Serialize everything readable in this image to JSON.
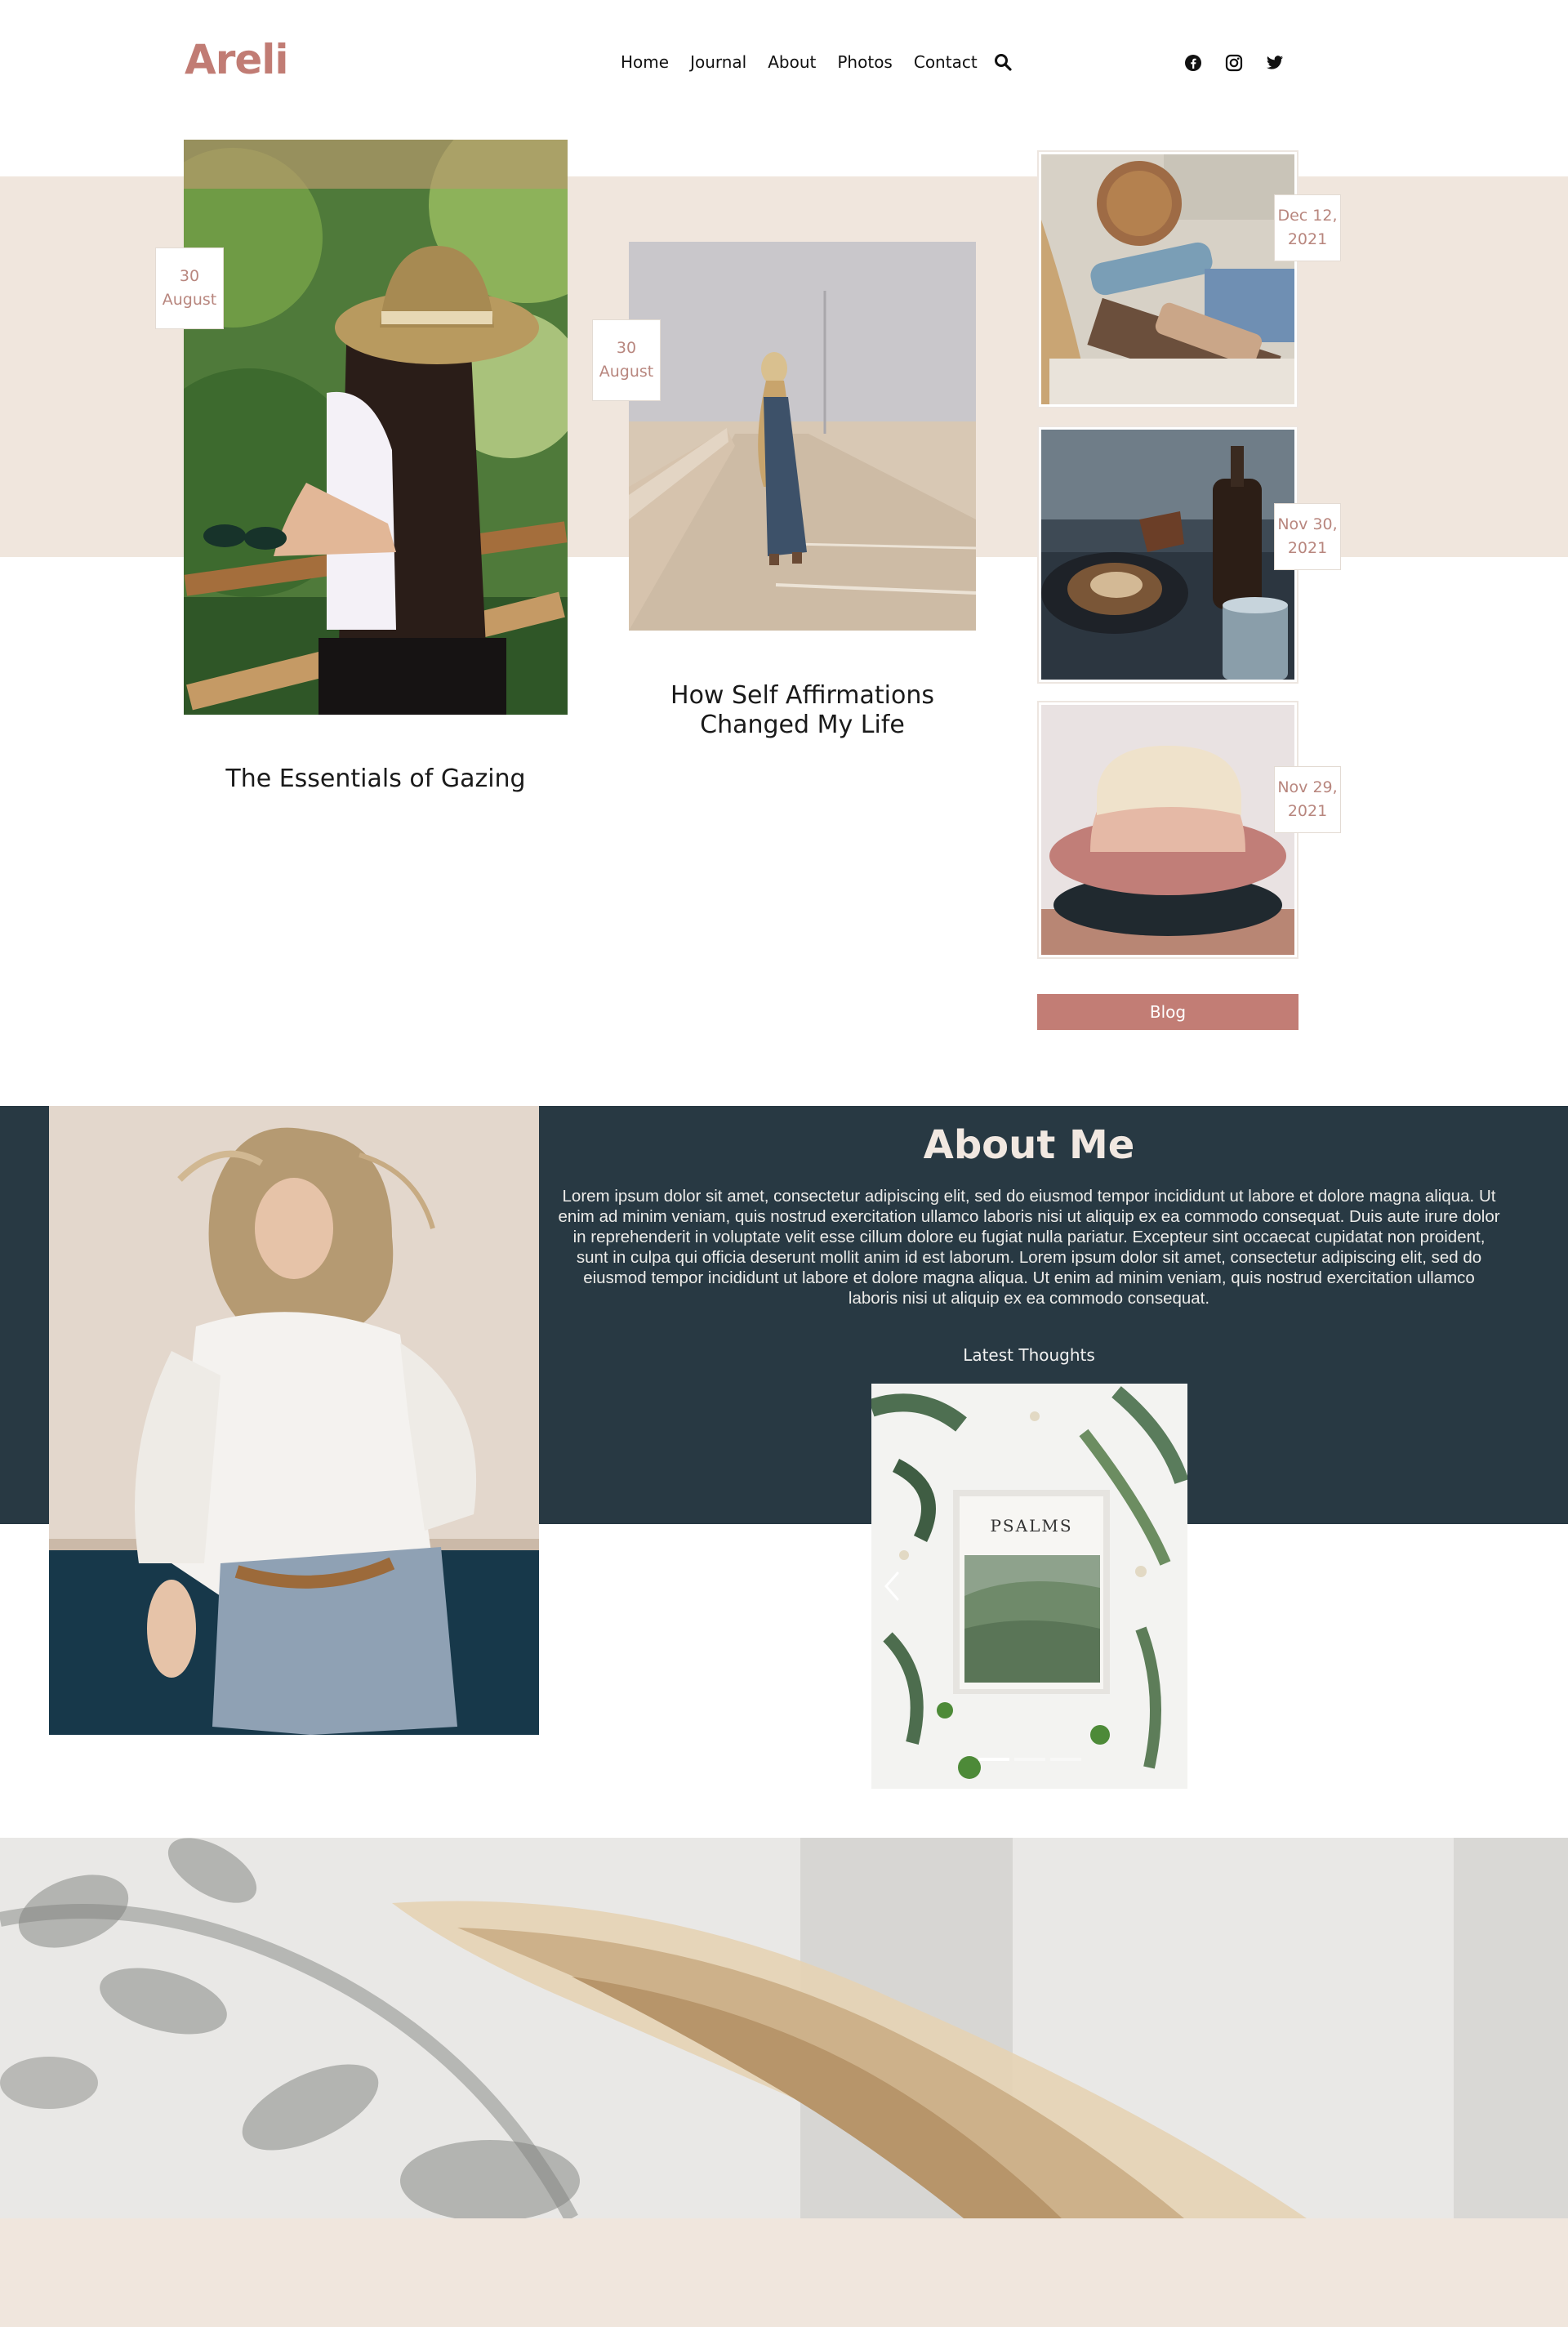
{
  "header": {
    "logo": "Areli",
    "nav": [
      "Home",
      "Journal",
      "About",
      "Photos",
      "Contact"
    ],
    "search_icon": "search-icon",
    "socials": [
      "facebook-icon",
      "instagram-icon",
      "twitter-icon"
    ]
  },
  "featured": [
    {
      "date_day": "30",
      "date_month": "August",
      "title": "The Essentials of Gazing"
    },
    {
      "date_day": "30",
      "date_month": "August",
      "title_line1": "How Self Affirmations",
      "title_line2": "Changed My Life"
    }
  ],
  "recent": [
    {
      "date_line1": "Dec 12,",
      "date_line2": "2021"
    },
    {
      "date_line1": "Nov 30,",
      "date_line2": "2021"
    },
    {
      "date_line1": "Nov 29,",
      "date_line2": "2021"
    }
  ],
  "blog_button": "Blog",
  "about": {
    "title": "About Me",
    "body": "Lorem ipsum dolor sit amet, consectetur adipiscing elit, sed do eiusmod tempor incididunt ut labore et dolore magna aliqua. Ut enim ad minim veniam, quis nostrud exercitation ullamco laboris nisi ut aliquip ex ea commodo consequat. Duis aute irure dolor in reprehenderit in voluptate velit esse cillum dolore eu fugiat nulla pariatur. Excepteur sint occaecat cupidatat non proident, sunt in culpa qui officia deserunt mollit anim id est laborum. Lorem ipsum dolor sit amet, consectetur adipiscing elit, sed do eiusmod tempor incididunt ut labore et dolore magna aliqua. Ut enim ad minim veniam, quis nostrud exercitation ullamco laboris nisi ut aliquip ex ea commodo consequat.",
    "latest_label": "Latest Thoughts",
    "slide_book_title": "PSALMS",
    "slider_dots": 3,
    "active_dot": 0
  },
  "colors": {
    "accent": "#c17c74",
    "band": "#f0e6dd",
    "dark": "#283943"
  }
}
